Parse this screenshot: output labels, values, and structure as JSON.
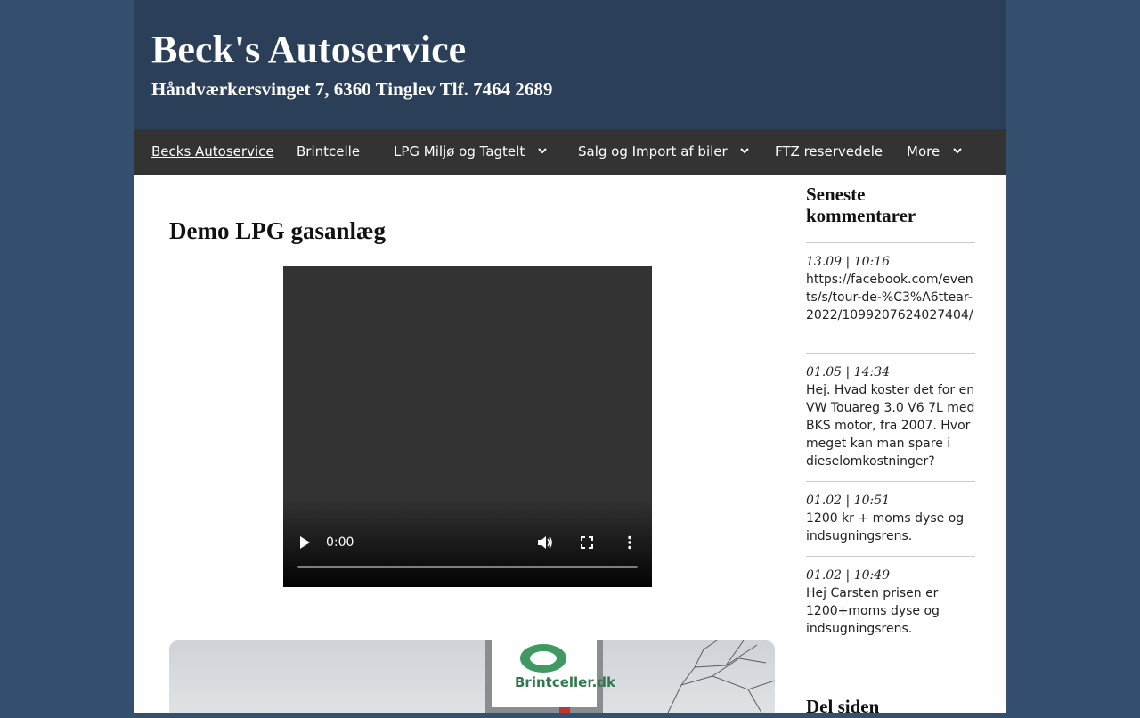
{
  "header": {
    "title": "Beck's Autoservice",
    "subtitle": "Håndværkersvinget 7, 6360 Tinglev Tlf. 7464 2689"
  },
  "nav": {
    "items": [
      {
        "label": "Becks Autoservice",
        "active": true,
        "dropdown": false
      },
      {
        "label": "Brintcelle",
        "active": false,
        "dropdown": false
      },
      {
        "label": "LPG Miljø og Tagtelt",
        "active": false,
        "dropdown": true
      },
      {
        "label": "Salg og Import af biler",
        "active": false,
        "dropdown": true
      },
      {
        "label": "FTZ reservedele",
        "active": false,
        "dropdown": false
      },
      {
        "label": "More",
        "active": false,
        "dropdown": true
      }
    ]
  },
  "main": {
    "title": "Demo LPG gasanlæg",
    "video": {
      "time": "0:00",
      "progress": 0
    },
    "photo": {
      "sign_text": "Brintceller.dk"
    }
  },
  "sidebar": {
    "comments_title": "Seneste kommentarer",
    "comments": [
      {
        "date": "13.09 | 10:16",
        "text": "https://facebook.com/events/s/tour-de-%C3%A6ttear-2022/1099207624027404/"
      },
      {
        "date": "01.05 | 14:34",
        "text": "Hej. Hvad koster det for en VW Touareg 3.0 V6 7L med BKS motor, fra 2007. Hvor meget kan man spare i dieselomkostninger?"
      },
      {
        "date": "01.02 | 10:51",
        "text": "1200 kr + moms dyse og indsugningsrens."
      },
      {
        "date": "01.02 | 10:49",
        "text": "Hej Carsten prisen er 1200+moms dyse og indsugningsrens."
      }
    ],
    "share_title": "Del siden"
  },
  "colors": {
    "background": "#34506e",
    "header": "#2b3f58",
    "nav": "#333333",
    "content": "#ffffff"
  }
}
